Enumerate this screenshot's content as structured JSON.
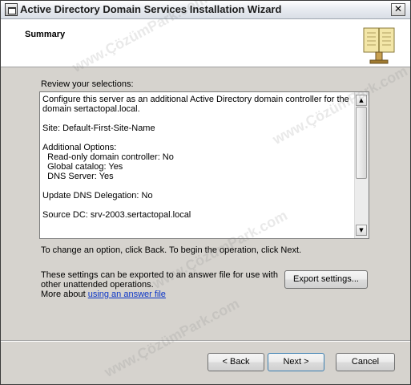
{
  "window": {
    "title": "Active Directory Domain Services Installation Wizard",
    "close_glyph": "✕"
  },
  "header": {
    "title": "Summary",
    "icon": "book-icon"
  },
  "review": {
    "label": "Review your selections:",
    "summary_text": "Configure this server as an additional Active Directory domain controller for the domain sertactopal.local.\n\nSite: Default-First-Site-Name\n\nAdditional Options:\n  Read-only domain controller: No\n  Global catalog: Yes\n  DNS Server: Yes\n\nUpdate DNS Delegation: No\n\nSource DC: srv-2003.sertactopal.local",
    "scroll_up": "▲",
    "scroll_down": "▼"
  },
  "hint": "To change an option, click Back. To begin the operation, click Next.",
  "export": {
    "text_line1": "These settings can be exported to an answer file for use with",
    "text_line2": "other unattended operations.",
    "more_prefix": "More about ",
    "link_label": "using an answer file",
    "button_label": "Export settings..."
  },
  "buttons": {
    "back": "< Back",
    "next": "Next >",
    "cancel": "Cancel"
  },
  "watermark": "www.ÇözümPark.com",
  "colors": {
    "link": "#0b35c7",
    "dialog_bg": "#d6d3ce"
  }
}
